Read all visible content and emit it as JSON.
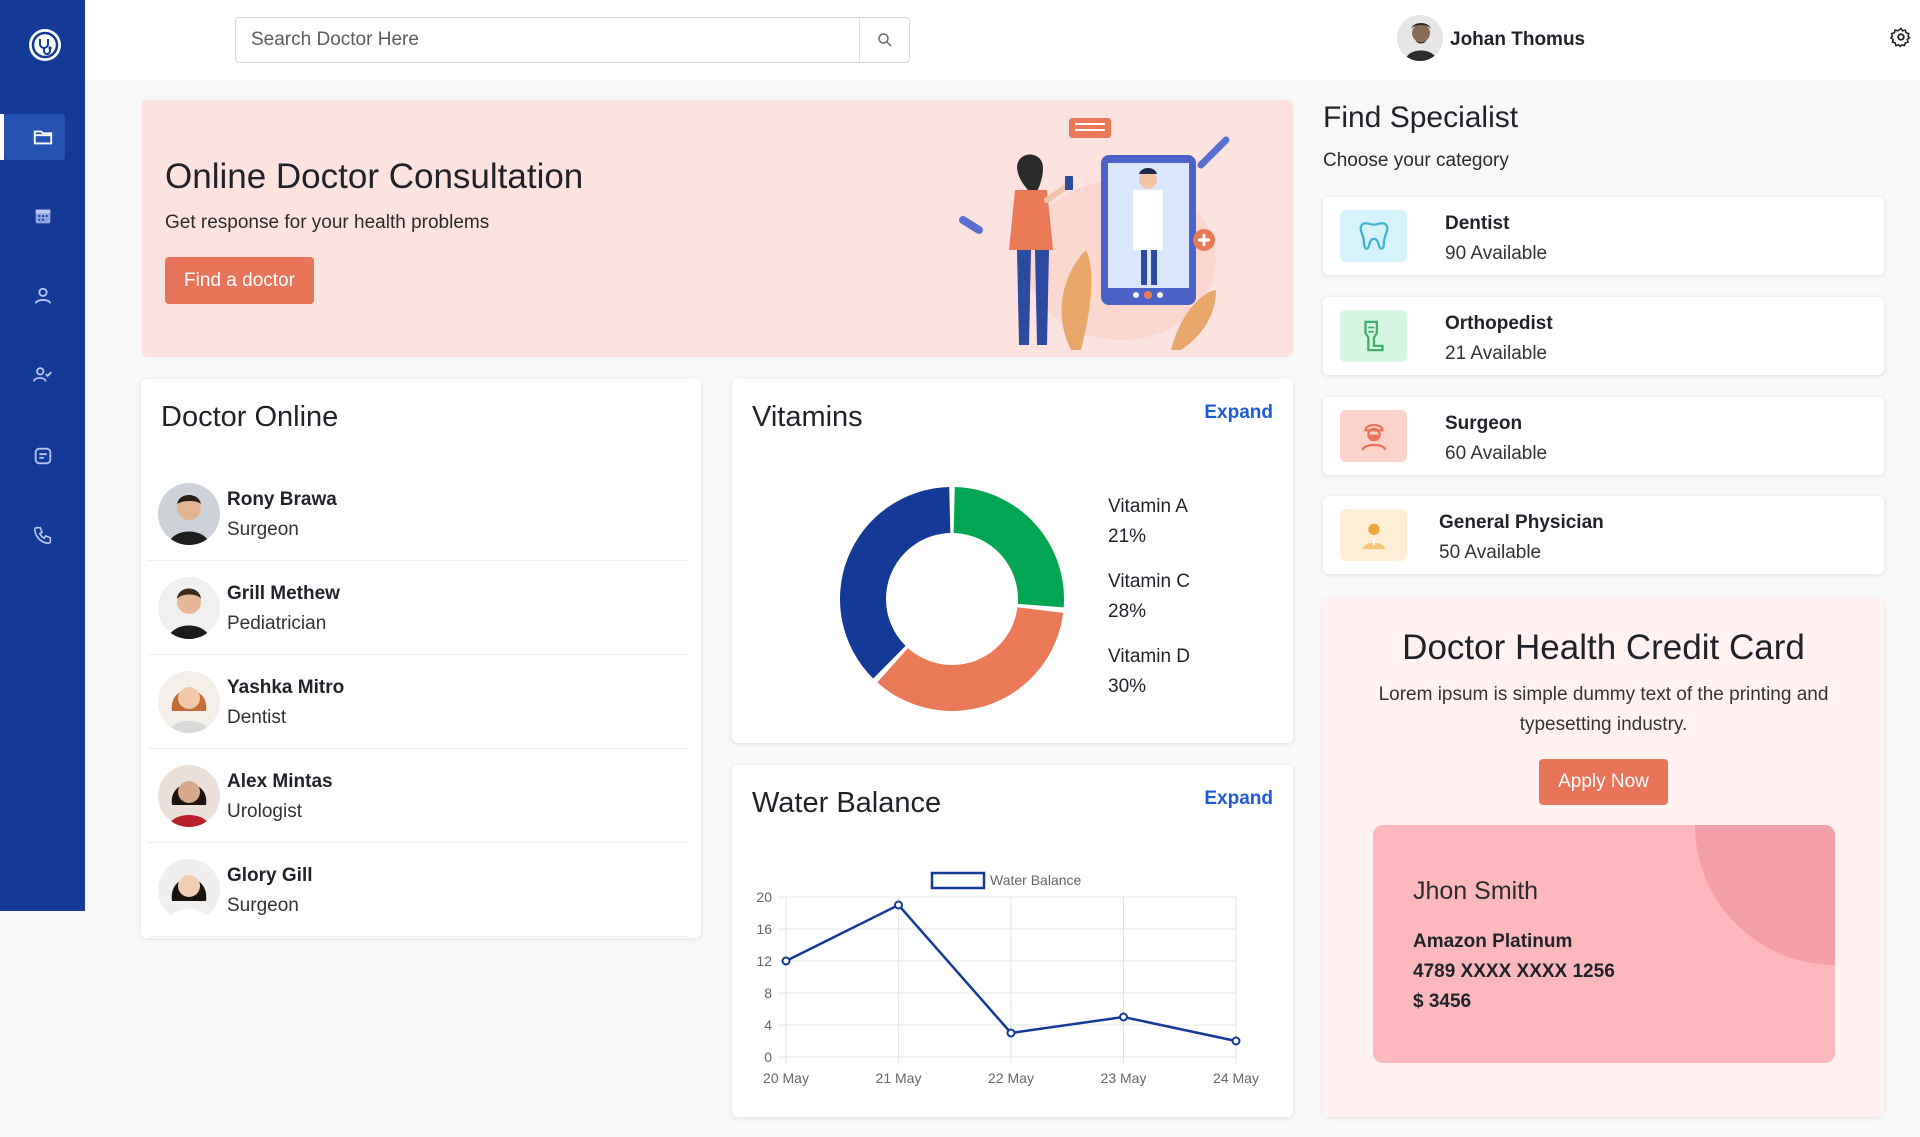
{
  "search": {
    "placeholder": "Search Doctor Here"
  },
  "user": {
    "name": "Johan Thomus"
  },
  "sidebar": {
    "items": [
      "folder-icon",
      "calendar-icon",
      "user-icon",
      "user-check-icon",
      "message-icon",
      "phone-icon"
    ],
    "active": "folder-icon"
  },
  "hero": {
    "title": "Online Doctor Consultation",
    "subtitle": "Get response for your health problems",
    "button": "Find a doctor"
  },
  "doctor_online": {
    "title": "Doctor Online",
    "doctors": [
      {
        "name": "Rony Brawa",
        "specialty": "Surgeon"
      },
      {
        "name": "Grill Methew",
        "specialty": "Pediatrician"
      },
      {
        "name": "Yashka Mitro",
        "specialty": "Dentist"
      },
      {
        "name": "Alex Mintas",
        "specialty": "Urologist"
      },
      {
        "name": "Glory Gill",
        "specialty": "Surgeon"
      }
    ]
  },
  "vitamins": {
    "title": "Vitamins",
    "expand": "Expand",
    "legend": [
      {
        "label": "Vitamin A",
        "pct": "21%",
        "color": "#00a651"
      },
      {
        "label": "Vitamin C",
        "pct": "28%",
        "color": "#ea7a57"
      },
      {
        "label": "Vitamin D",
        "pct": "30%",
        "color": "#123a96"
      }
    ]
  },
  "water": {
    "title": "Water Balance",
    "expand": "Expand"
  },
  "specialist": {
    "title": "Find Specialist",
    "subtitle": "Choose your category",
    "items": [
      {
        "name": "Dentist",
        "available": "90 Available",
        "icon": "tooth-icon",
        "bg": "#d6f3fb",
        "fg": "#3fb3cf"
      },
      {
        "name": "Orthopedist",
        "available": "21 Available",
        "icon": "leg-icon",
        "bg": "#d5f7e1",
        "fg": "#3fae6a"
      },
      {
        "name": "Surgeon",
        "available": "60 Available",
        "icon": "surgeon-icon",
        "bg": "#fbd3cb",
        "fg": "#e8745a"
      },
      {
        "name": "General Physician",
        "available": "50 Available",
        "icon": "physician-icon",
        "bg": "#fdeed5",
        "fg": "#f0a73a"
      }
    ]
  },
  "credit": {
    "title": "Doctor Health Credit Card",
    "description": "Lorem ipsum is simple dummy text of the printing and typesetting industry.",
    "button": "Apply Now",
    "card": {
      "holder": "Jhon Smith",
      "type": "Amazon Platinum",
      "number": "4789 XXXX XXXX 1256",
      "balance": "$ 3456"
    }
  },
  "chart_data": [
    {
      "type": "pie",
      "title": "Vitamins",
      "categories": [
        "Vitamin A",
        "Vitamin C",
        "Vitamin D"
      ],
      "values": [
        21,
        28,
        30
      ],
      "colors": [
        "#00a651",
        "#ea7a57",
        "#123a96"
      ],
      "donut": true,
      "legend": "right"
    },
    {
      "type": "line",
      "title": "Water Balance",
      "x": [
        "20 May",
        "21 May",
        "22 May",
        "23 May",
        "24 May"
      ],
      "series": [
        {
          "name": "Water Balance",
          "values": [
            12,
            19,
            3,
            5,
            2
          ],
          "color": "#123a96"
        }
      ],
      "ylim": [
        0,
        20
      ],
      "yticks": [
        0,
        4,
        8,
        12,
        16,
        20
      ],
      "grid": true,
      "legend": "top"
    }
  ]
}
